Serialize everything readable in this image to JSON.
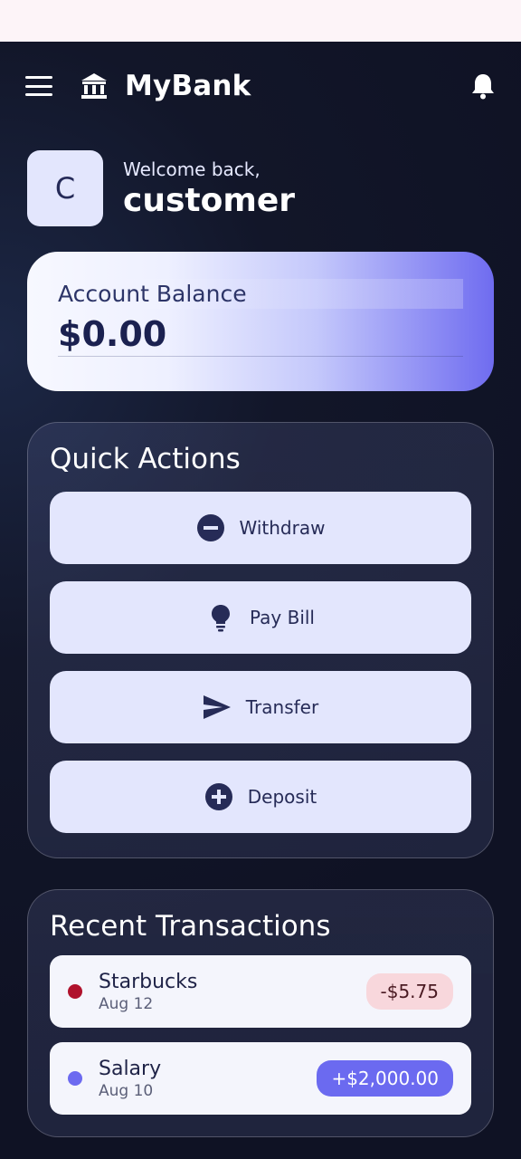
{
  "app": {
    "name": "MyBank"
  },
  "welcome": {
    "avatar_initial": "C",
    "greeting": "Welcome back,",
    "name": "customer"
  },
  "balance": {
    "label": "Account Balance",
    "amount": "$0.00"
  },
  "quick_actions": {
    "title": "Quick Actions",
    "items": [
      {
        "label": "Withdraw",
        "icon": "minus-circle-icon"
      },
      {
        "label": "Pay Bill",
        "icon": "lightbulb-icon"
      },
      {
        "label": "Transfer",
        "icon": "send-icon"
      },
      {
        "label": "Deposit",
        "icon": "plus-circle-icon"
      }
    ]
  },
  "transactions": {
    "title": "Recent Transactions",
    "items": [
      {
        "name": "Starbucks",
        "date": "Aug 12",
        "amount": "-$5.75",
        "dot_color": "#b0122c",
        "amount_bg": "#f8d7dc",
        "amount_color": "#4a1a22"
      },
      {
        "name": "Salary",
        "date": "Aug 10",
        "amount": "+$2,000.00",
        "dot_color": "#6c6af0",
        "amount_bg": "#6b6af0",
        "amount_color": "#ffffff"
      }
    ]
  },
  "colors": {
    "accent": "#6f6cf0",
    "button_bg": "#e3e6fd",
    "text_dark": "#262b57"
  }
}
